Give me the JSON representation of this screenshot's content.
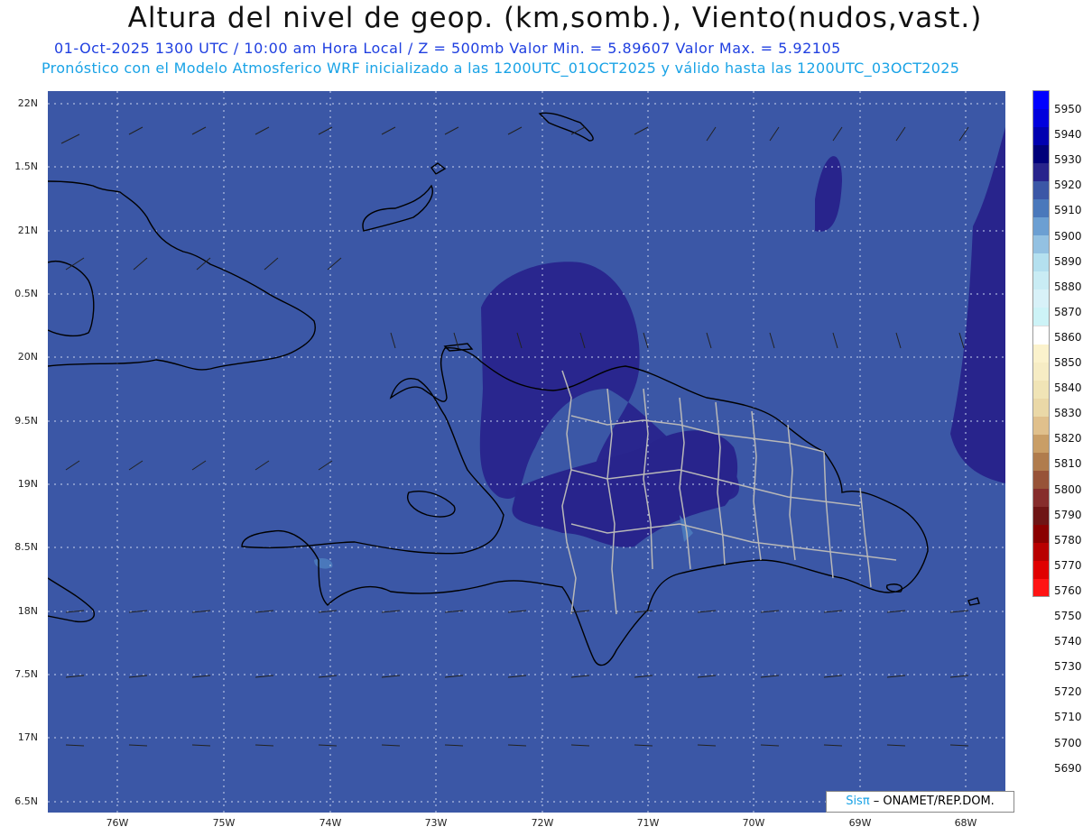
{
  "header": {
    "title": "Altura del nivel de geop. (km,somb.), Viento(nudos,vast.)",
    "subtitle1": "01-Oct-2025  1300 UTC / 10:00 am Hora Local / Z = 500mb    Valor Min. = 5.89607  Valor Max. = 5.92105",
    "subtitle2": "Pronóstico con el Modelo Atmosferico WRF inicializado a las 1200UTC_01OCT2025 y válido hasta las  1200UTC_03OCT2025"
  },
  "axes": {
    "lat_labels": [
      "22N",
      "1.5N",
      "21N",
      "0.5N",
      "20N",
      "9.5N",
      "19N",
      "8.5N",
      "18N",
      "7.5N",
      "17N",
      "6.5N"
    ],
    "lon_labels": [
      "76W",
      "75W",
      "74W",
      "73W",
      "72W",
      "71W",
      "70W",
      "69W",
      "68W"
    ]
  },
  "colorbar": {
    "labels": [
      "5950",
      "5940",
      "5930",
      "5920",
      "5910",
      "5900",
      "5890",
      "5880",
      "5870",
      "5860",
      "5850",
      "5840",
      "5830",
      "5820",
      "5810",
      "5800",
      "5790",
      "5780",
      "5770",
      "5760",
      "5750",
      "5740",
      "5730",
      "5720",
      "5710",
      "5700",
      "5690"
    ],
    "colors": [
      "#0000ff",
      "#0000dd",
      "#0000b0",
      "#00007a",
      "#28248c",
      "#3b57a6",
      "#4a78bb",
      "#6c9fd2",
      "#93c1e2",
      "#b4e0ef",
      "#c9ecf4",
      "#d8f1f8",
      "#cdf3f7",
      "#ffffff",
      "#fbf2cc",
      "#f6ecc4",
      "#f0e4b6",
      "#ead8a7",
      "#e0c08c",
      "#c99e66",
      "#b07c4d",
      "#975338",
      "#862d2c",
      "#6e1515",
      "#8a0000",
      "#b80000",
      "#e00000",
      "#ff1414"
    ]
  },
  "credit": {
    "brand": "Sisπ",
    "text": " – ONAMET/REP.DOM."
  }
}
